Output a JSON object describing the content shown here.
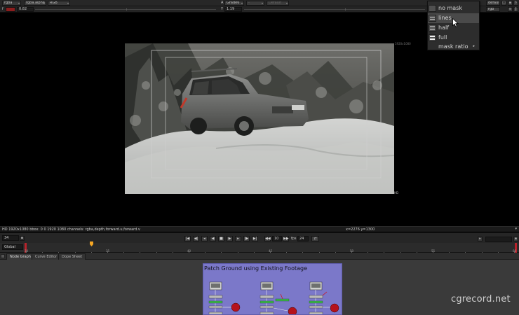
{
  "viewer_toolbar": {
    "channels": "rgba",
    "alpha_channel": "rgba.alpha",
    "colorspace": "RGB",
    "input_a_label": "A",
    "input_a_node": "Grade6",
    "input_b_node": "-",
    "compare_mode": "Default",
    "gain_label": "f",
    "gain_value": "0.82",
    "gamma_label": "Y",
    "gamma_value": "1.19",
    "right_dropdown_top": "default",
    "right_dropdown_bottom": "rgb"
  },
  "mask_menu": {
    "items": [
      {
        "label": "no mask"
      },
      {
        "label": "lines"
      },
      {
        "label": "half"
      },
      {
        "label": "full"
      },
      {
        "label": "mask ratio",
        "submenu": "▸"
      }
    ],
    "highlighted": "lines"
  },
  "viewer": {
    "format_label": "1920x1080",
    "corner_label": "HD"
  },
  "info_bar": {
    "text": "HD 1920x1080 bbox: 0 0 1920 1080 channels: rgba,depth,forward.u,forward.v",
    "coords": "x=2276 y=1300"
  },
  "playback": {
    "current_frame": "34",
    "scope": "Global",
    "increment_label": "10",
    "fps_label": "fps",
    "fps_value": "24"
  },
  "timeline": {
    "ticks": [
      "30",
      "35",
      "40",
      "45",
      "50",
      "55",
      "60"
    ],
    "start_frame": "30",
    "playhead_frame": 34
  },
  "panel_tabs": [
    "Node Graph",
    "Curve Editor",
    "Dope Sheet"
  ],
  "node_graph": {
    "backdrop_title": "Patch Ground using Existing Footage"
  },
  "watermark": "cgrecord.net",
  "colors": {
    "backdrop": "#7b78c9",
    "menu_bg": "#2d2d2d",
    "highlight": "#4a4a4a",
    "merge_node": "#b5121b",
    "grade_node": "#3cb44a"
  }
}
